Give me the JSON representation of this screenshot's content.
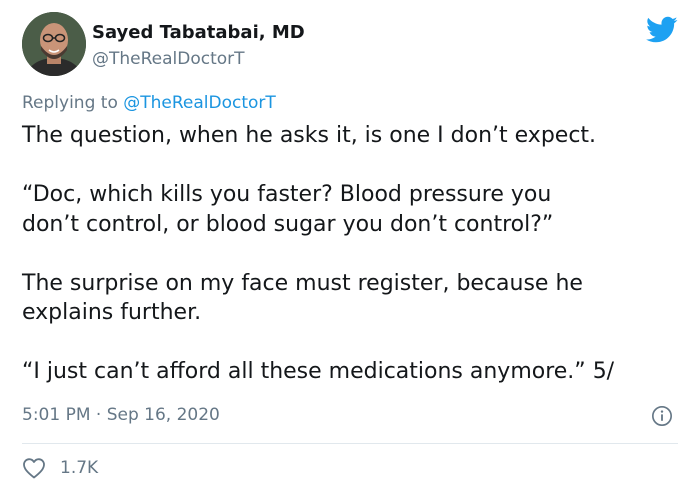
{
  "author": {
    "name": "Sayed Tabatabai, MD",
    "handle": "@TheRealDoctorT",
    "avatar_icon": "profile-photo"
  },
  "reply": {
    "prefix": "Replying to ",
    "target": "@TheRealDoctorT"
  },
  "tweet": {
    "lines": [
      "The question, when he asks it, is one I don’t expect.",
      "“Doc, which kills you faster?  Blood pressure you",
      "don’t control, or blood sugar you don’t control?”",
      "The surprise on my face must register, because he",
      "explains further.",
      "“I just can’t afford all these medications anymore.” 5/"
    ]
  },
  "meta": {
    "time": "5:01 PM",
    "separator": " · ",
    "date": "Sep 16, 2020"
  },
  "engagement": {
    "likes": "1.7K"
  },
  "icons": {
    "brand": "twitter-bird-icon",
    "info": "info-icon",
    "like": "heart-icon"
  },
  "colors": {
    "twitter_blue": "#1da1f2",
    "link_blue": "#1b95e0",
    "secondary_text": "#657786",
    "primary_text": "#14171a",
    "divider": "#e1e8ed"
  }
}
